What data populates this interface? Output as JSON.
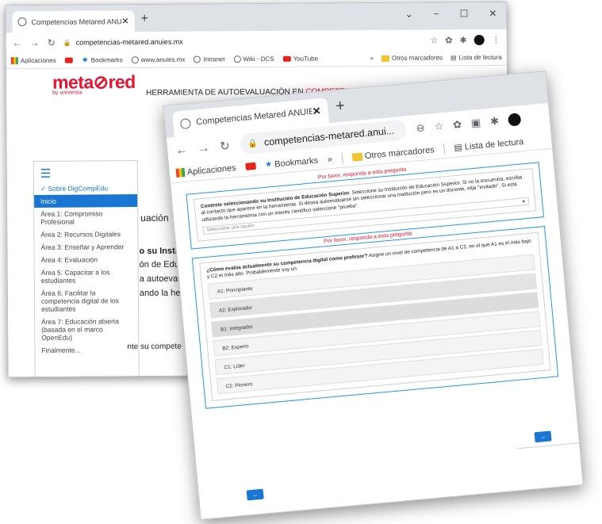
{
  "back_window": {
    "tab_title": "Competencias Metared ANUIES",
    "tab_close": "✕",
    "new_tab": "+",
    "window_controls": [
      "⌄",
      "−",
      "☐",
      "✕"
    ],
    "url": "competencias-metared.anuies.mx",
    "bookmarks": [
      "Aplicaciones",
      "Bookmarks",
      "www.anuies.mx",
      "Intranet",
      "Wiki - DCS",
      "YouTube"
    ],
    "bookmarks_overflow": "»",
    "other_bookmarks": "Otros marcadores",
    "reading_list": "Lista de lectura",
    "logo_text": "meta⊘red",
    "logo_sub": "by universia",
    "header_prefix": "HERRAMIENTA DE AUTOEVALUACIÓN EN ",
    "header_highlight": "COMPETENCIAS DIGITALES DOCENTES",
    "sidebar": {
      "items": [
        "✓ Sobre DigCompEdu",
        "Inicio",
        "Área 1: Compromiso Profesional",
        "Área 2: Recursos Digitales",
        "Área 3: Enseñar y Aprender",
        "Área 4: Evaluación",
        "Área 5: Capacitar a los estudiantes",
        "Área 6: Facilitar la competencia digital de los estudiantes",
        "Área 7: Educación abierta (basada en el marco OpenEdu)",
        "Finalmente..."
      ]
    },
    "fragments": [
      "uación",
      "o su Instituci",
      "ón de Educac",
      "a autoevalua",
      "ando la herra",
      "nte su compete"
    ]
  },
  "front_window": {
    "tab_title": "Competencias Metared ANUIES",
    "tab_close": "✕",
    "new_tab": "+",
    "url": "competencias-metared.anui...",
    "bookmarks": [
      "Aplicaciones",
      "Bookmarks"
    ],
    "bookmarks_overflow": "»",
    "other_bookmarks": "Otros marcadores",
    "reading_list": "Lista de lectura",
    "required_msg": "Por favor, responda a esta pregunta",
    "q1": {
      "title_bold": "Conteste seleccionando su Institución de Educación Superior.",
      "body": " Seleccione su Institución de Educación Superior. Si no la encuentra, escriba al contacto que aparece en la herramienta. Si desea autoevaluarse sin seleccionar una institución pero es un docente, elija \"invitado\". Si está utilizando la herramienta con un interés científico seleccione \"prueba\".",
      "placeholder": "Seleccione una opción"
    },
    "q2": {
      "title_bold": "¿Cómo evalúa actualmente su competencia digital como profesor?",
      "body": " Asigne un nivel de competencia de A1 a C2, en el que A1 es el más bajo y C2 el más alto. Probablemente soy un",
      "options": [
        "A1: Principiante",
        "A2: Explorador",
        "B1: Integrador",
        "B2: Experto",
        "C1: Líder",
        "C2: Pionero"
      ]
    },
    "next_label": "→",
    "prev_label": "←"
  }
}
